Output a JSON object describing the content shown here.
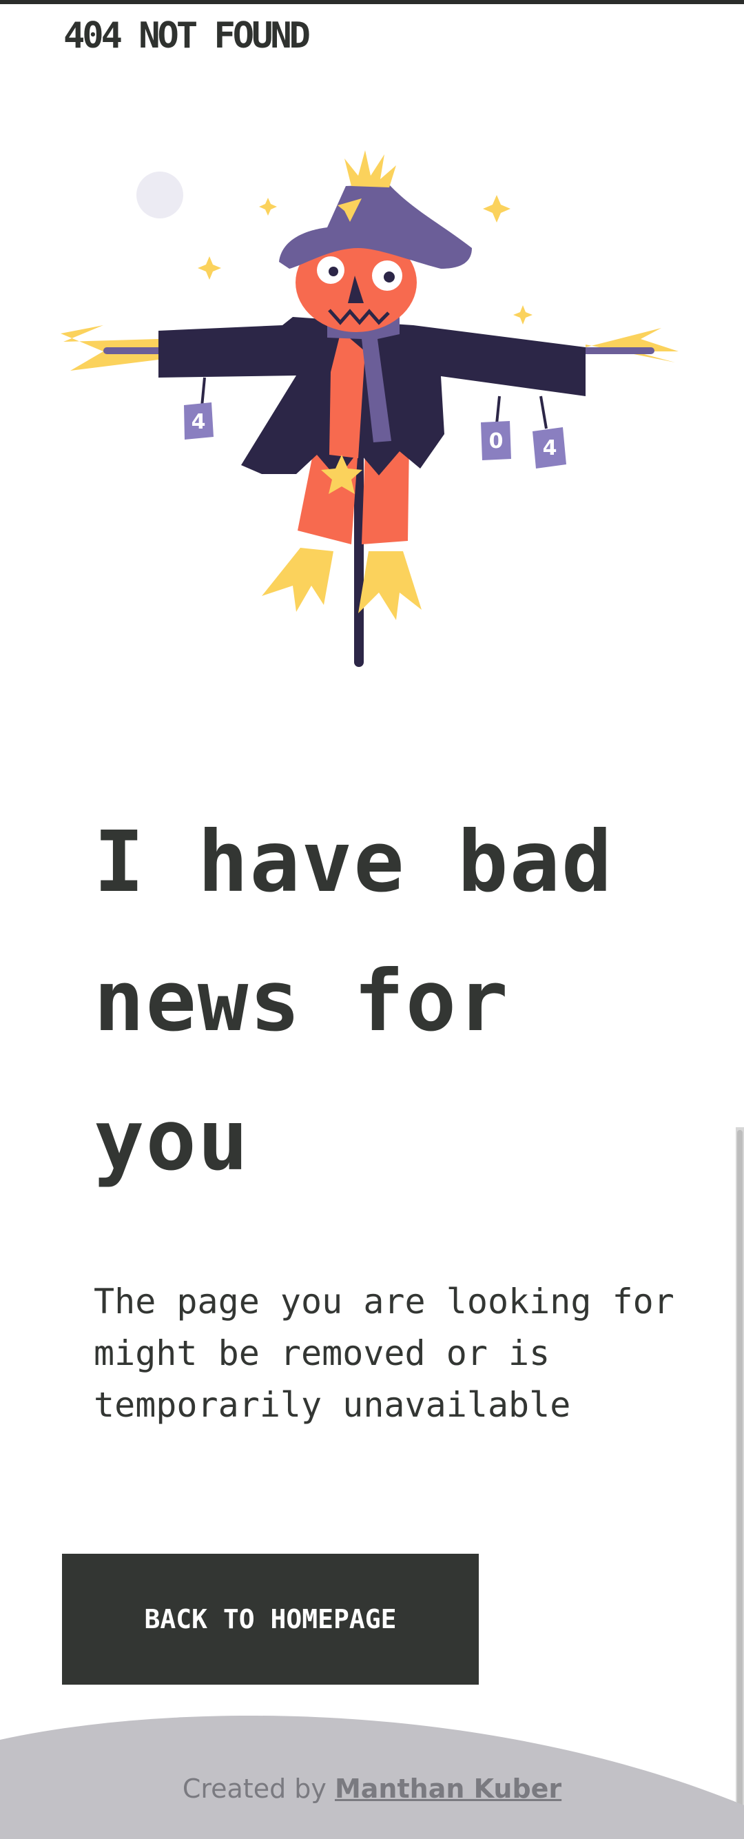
{
  "header": {
    "brand": "404 NOT FOUND"
  },
  "illustration": {
    "can_labels": [
      "4",
      "0",
      "4"
    ],
    "colors": {
      "hat": "#6b5e98",
      "coat": "#2c2647",
      "face": "#f76a4f",
      "straw": "#fbd25c",
      "moon": "#ecebf3",
      "pole": "#2c2647"
    }
  },
  "main": {
    "heading": "I have bad news for you",
    "message": "The page you are looking for might be removed or is temporarily unavailable",
    "cta_label": "BACK TO HOMEPAGE"
  },
  "footer": {
    "credit_prefix": "Created by ",
    "author": "Manthan Kuber"
  },
  "colors": {
    "text": "#333633",
    "button_bg": "#333633",
    "footer_wave": "#c2c1c6"
  }
}
